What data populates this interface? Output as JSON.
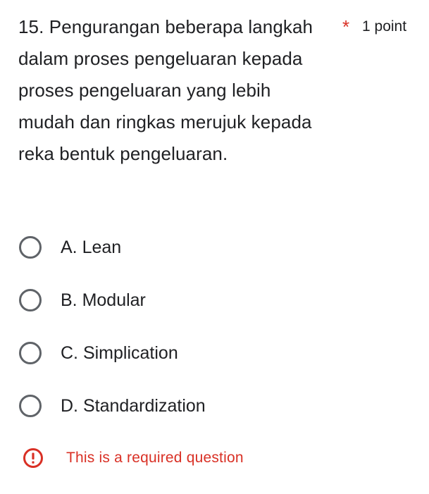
{
  "question": {
    "text": "15.  Pengurangan beberapa langkah dalam proses pengeluaran kepada proses pengeluaran yang lebih mudah dan ringkas merujuk kepada reka bentuk pengeluaran.",
    "required_mark": "*",
    "points_label": "1 point"
  },
  "options": [
    {
      "label": "A. Lean",
      "selected": false
    },
    {
      "label": "B. Modular",
      "selected": false
    },
    {
      "label": "C. Simplication",
      "selected": false
    },
    {
      "label": "D. Standardization",
      "selected": false
    }
  ],
  "validation": {
    "icon": "error-exclamation-icon",
    "message": "This is a required question",
    "color": "#d93025"
  }
}
